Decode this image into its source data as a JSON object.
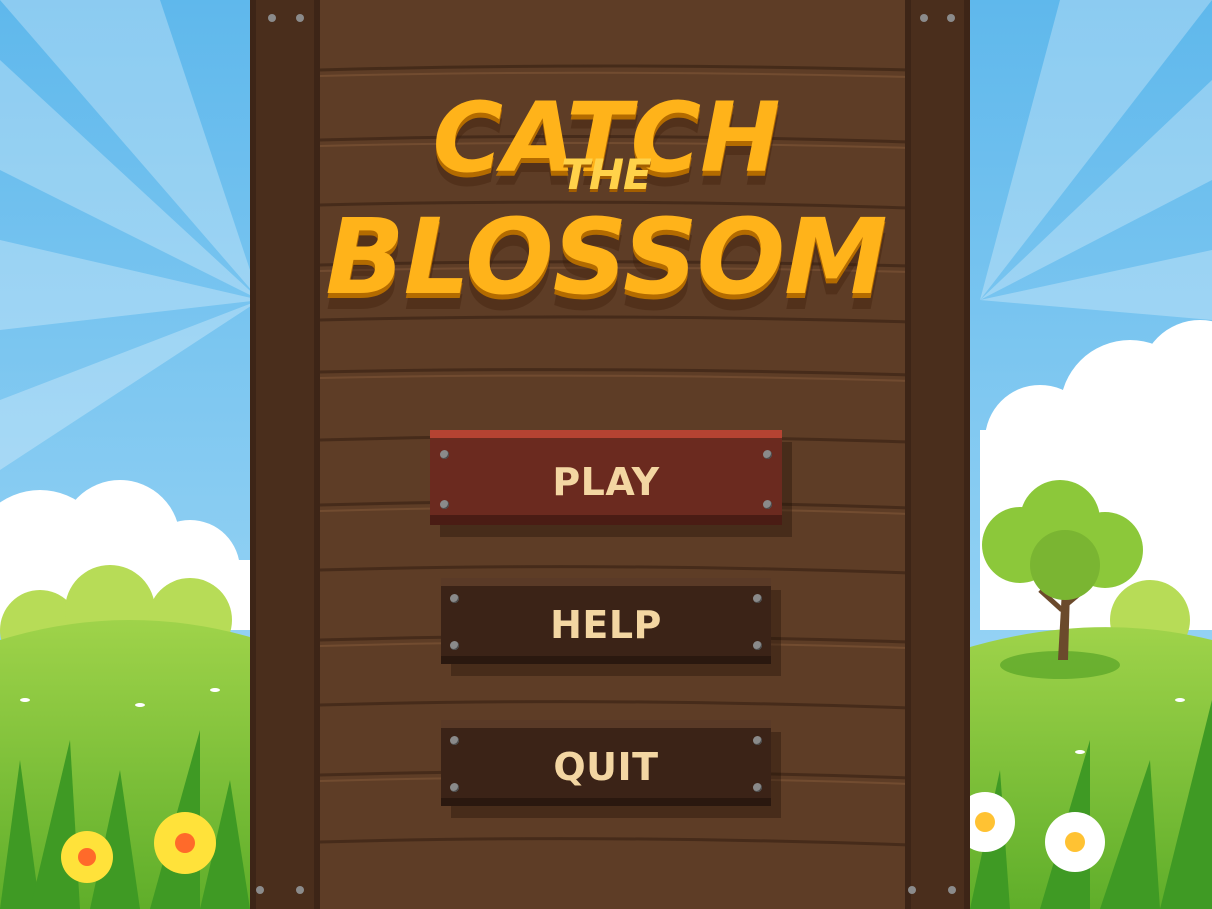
{
  "game": {
    "title_line1": "CATCH",
    "title_line2": "THE",
    "title_line3": "BLOSSOM"
  },
  "menu": {
    "play_label": "PLAY",
    "help_label": "HELP",
    "quit_label": "QUIT"
  },
  "colors": {
    "sky": "#7cc6ee",
    "wood": "#5e3d26",
    "title": "#ffb31a",
    "play_button": "#6b2a1f",
    "dark_button": "#3b2317",
    "button_text": "#f3d6a2"
  }
}
